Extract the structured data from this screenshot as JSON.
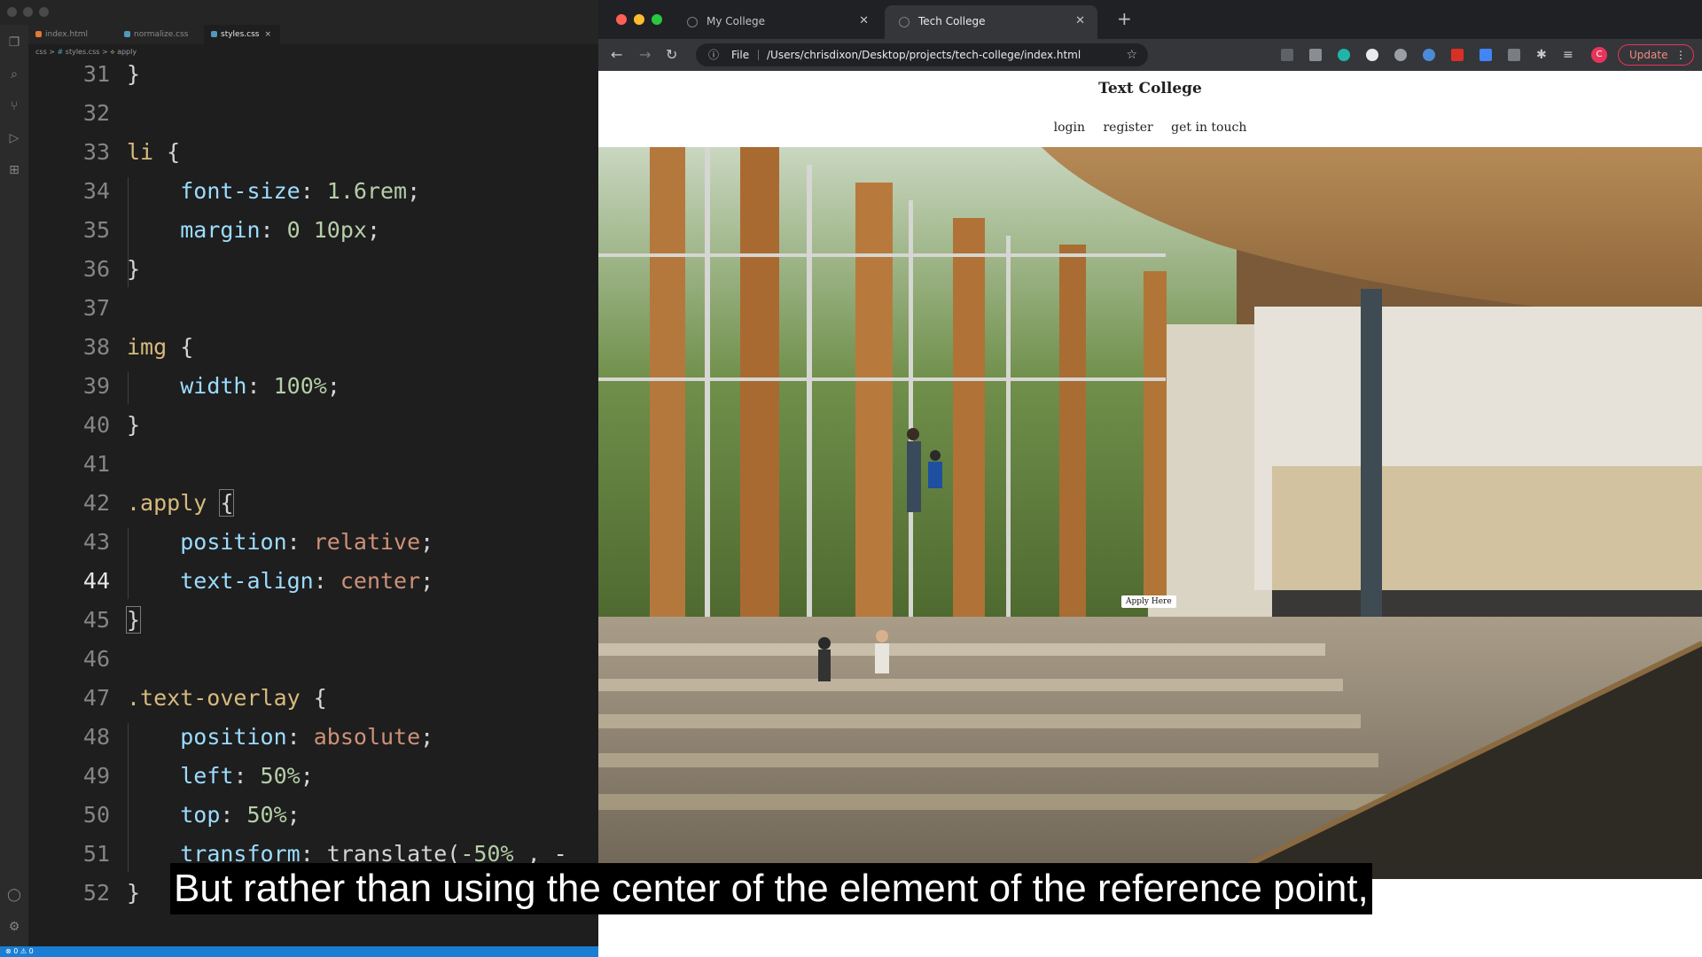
{
  "editor": {
    "tabs": [
      {
        "label": "index.html",
        "icon": "html-icon"
      },
      {
        "label": "normalize.css",
        "icon": "css-icon"
      },
      {
        "label": "styles.css",
        "icon": "css-icon",
        "active": true
      }
    ],
    "breadcrumb": [
      "css",
      "styles.css",
      "apply"
    ],
    "lines": [
      {
        "n": "31",
        "tokens": [
          [
            "p",
            "}"
          ]
        ]
      },
      {
        "n": "32",
        "tokens": []
      },
      {
        "n": "33",
        "tokens": [
          [
            "sel",
            "li"
          ],
          [
            "p",
            " {"
          ]
        ]
      },
      {
        "n": "34",
        "tokens": [
          [
            "p",
            "    "
          ],
          [
            "prop",
            "font-size"
          ],
          [
            "p",
            ": "
          ],
          [
            "num",
            "1.6rem"
          ],
          [
            "p",
            ";"
          ]
        ]
      },
      {
        "n": "35",
        "tokens": [
          [
            "p",
            "    "
          ],
          [
            "prop",
            "margin"
          ],
          [
            "p",
            ": "
          ],
          [
            "num",
            "0 10px"
          ],
          [
            "p",
            ";"
          ]
        ]
      },
      {
        "n": "36",
        "tokens": [
          [
            "p",
            "}"
          ]
        ]
      },
      {
        "n": "37",
        "tokens": []
      },
      {
        "n": "38",
        "tokens": [
          [
            "sel",
            "img"
          ],
          [
            "p",
            " {"
          ]
        ]
      },
      {
        "n": "39",
        "tokens": [
          [
            "p",
            "    "
          ],
          [
            "prop",
            "width"
          ],
          [
            "p",
            ": "
          ],
          [
            "num",
            "100%"
          ],
          [
            "p",
            ";"
          ]
        ]
      },
      {
        "n": "40",
        "tokens": [
          [
            "p",
            "}"
          ]
        ]
      },
      {
        "n": "41",
        "tokens": []
      },
      {
        "n": "42",
        "tokens": [
          [
            "sel",
            ".apply"
          ],
          [
            "p",
            " "
          ],
          [
            "brk",
            "{"
          ]
        ]
      },
      {
        "n": "43",
        "tokens": [
          [
            "p",
            "    "
          ],
          [
            "prop",
            "position"
          ],
          [
            "p",
            ": "
          ],
          [
            "val",
            "relative"
          ],
          [
            "p",
            ";"
          ]
        ]
      },
      {
        "n": "44",
        "tokens": [
          [
            "p",
            "    "
          ],
          [
            "prop",
            "text-align"
          ],
          [
            "p",
            ": "
          ],
          [
            "val",
            "center"
          ],
          [
            "p",
            ";"
          ]
        ],
        "current": true
      },
      {
        "n": "45",
        "tokens": [
          [
            "brk",
            "}"
          ]
        ]
      },
      {
        "n": "46",
        "tokens": []
      },
      {
        "n": "47",
        "tokens": [
          [
            "sel",
            ".text-overlay"
          ],
          [
            "p",
            " {"
          ]
        ]
      },
      {
        "n": "48",
        "tokens": [
          [
            "p",
            "    "
          ],
          [
            "prop",
            "position"
          ],
          [
            "p",
            ": "
          ],
          [
            "val",
            "absolute"
          ],
          [
            "p",
            ";"
          ]
        ]
      },
      {
        "n": "49",
        "tokens": [
          [
            "p",
            "    "
          ],
          [
            "prop",
            "left"
          ],
          [
            "p",
            ": "
          ],
          [
            "num",
            "50%"
          ],
          [
            "p",
            ";"
          ]
        ]
      },
      {
        "n": "50",
        "tokens": [
          [
            "p",
            "    "
          ],
          [
            "prop",
            "top"
          ],
          [
            "p",
            ": "
          ],
          [
            "num",
            "50%"
          ],
          [
            "p",
            ";"
          ]
        ]
      },
      {
        "n": "51",
        "tokens": [
          [
            "p",
            "    "
          ],
          [
            "prop",
            "transform"
          ],
          [
            "p",
            ": translate("
          ],
          [
            "num",
            "-50%"
          ],
          [
            "p",
            " , -"
          ]
        ]
      },
      {
        "n": "52",
        "tokens": [
          [
            "p",
            "}"
          ]
        ]
      }
    ]
  },
  "browser": {
    "tabs": [
      {
        "label": "My College"
      },
      {
        "label": "Tech College",
        "active": true
      }
    ],
    "address": {
      "scheme_label": "File",
      "url": "/Users/chrisdixon/Desktop/projects/tech-college/index.html"
    },
    "profile_initial": "C",
    "update_label": "Update",
    "colors": {
      "update": "#e8345b",
      "tab_bg": "#35363a",
      "strip_bg": "#202124"
    }
  },
  "page": {
    "title": "Text College",
    "nav": [
      "login",
      "register",
      "get in touch"
    ],
    "apply_button": "Apply Here"
  },
  "caption": "But rather than using the center of the element of the reference point,"
}
